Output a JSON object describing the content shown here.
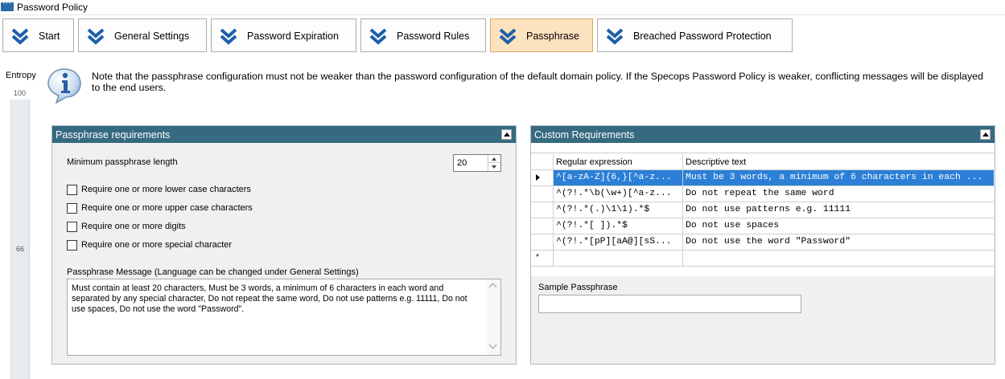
{
  "window": {
    "title": "Password Policy"
  },
  "tabs": [
    {
      "label": "Start"
    },
    {
      "label": "General Settings"
    },
    {
      "label": "Password Expiration"
    },
    {
      "label": "Password Rules"
    },
    {
      "label": "Passphrase",
      "active": true
    },
    {
      "label": "Breached Password Protection"
    }
  ],
  "entropy": {
    "label": "Entropy",
    "max": "100",
    "value": "66"
  },
  "note": "Note that the passphrase configuration must not be weaker than the password configuration of the default domain policy. If the Specops Password Policy is weaker, conflicting messages will be displayed to the end users.",
  "requirements": {
    "title": "Passphrase requirements",
    "min_length_label": "Minimum passphrase length",
    "min_length_value": "20",
    "checkboxes": [
      {
        "label": "Require one or more lower case characters",
        "checked": false
      },
      {
        "label": "Require one or more upper case characters",
        "checked": false
      },
      {
        "label": "Require one or more digits",
        "checked": false
      },
      {
        "label": "Require one or more special character",
        "checked": false
      }
    ],
    "message_label": "Passphrase Message (Language can be changed under General Settings)",
    "message_text": "Must contain at least 20 characters, Must be 3 words, a minimum of 6 characters in each word and separated by any special character, Do not repeat the same word, Do not use patterns e.g. 11111, Do not use spaces, Do not use the word \"Password\"."
  },
  "custom": {
    "title": "Custom Requirements",
    "columns": [
      "Regular expression",
      "Descriptive text"
    ],
    "rows": [
      {
        "regex": "^[a-zA-Z]{6,}[^a-z...",
        "text": "Must be 3 words, a minimum of 6 characters in each ..."
      },
      {
        "regex": "^(?!.*\\b(\\w+)[^a-z...",
        "text": "Do not repeat the same word"
      },
      {
        "regex": "^(?!.*(.)\\1\\1).*$",
        "text": "Do not use patterns e.g. 11111"
      },
      {
        "regex": "^(?!.*[ ]).*$",
        "text": "Do not use spaces"
      },
      {
        "regex": "^(?!.*[pP][aA@][sS...",
        "text": "Do not use the word \"Password\""
      }
    ],
    "sample_label": "Sample Passphrase",
    "sample_value": ""
  },
  "colors": {
    "panel_header": "#356a80",
    "active_tab": "#fde2bf",
    "selection": "#2b7fd6",
    "chevron": "#1e5fa8"
  },
  "icons": {
    "tab": "double-chevron-down-icon",
    "info": "info-icon"
  }
}
